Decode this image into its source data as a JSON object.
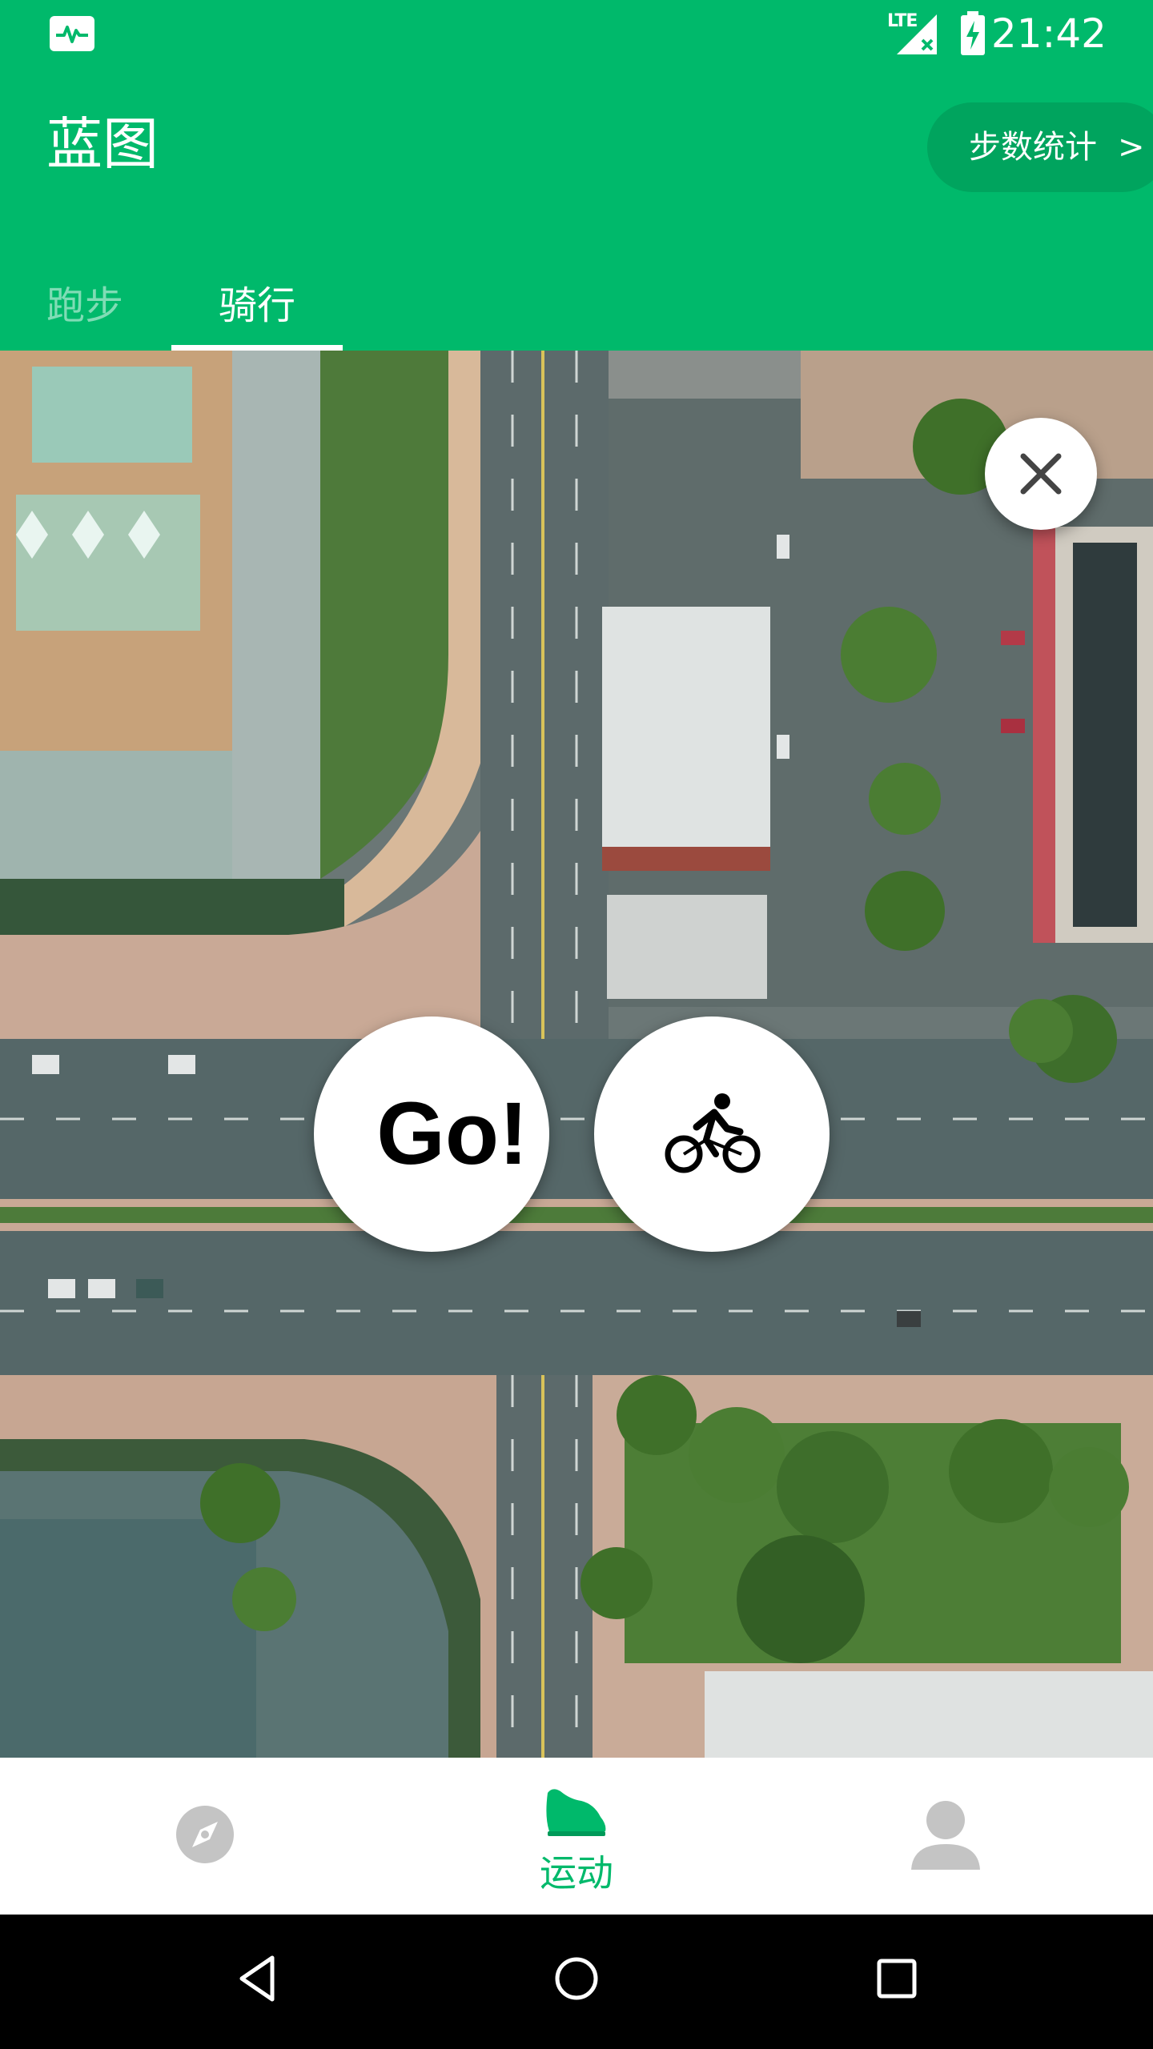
{
  "status_bar": {
    "network": "LTE",
    "time": "21:42",
    "icons": [
      "activity-app-icon",
      "signal-icon",
      "battery-charging-icon"
    ]
  },
  "app_bar": {
    "title": "蓝图",
    "steps_button_label": "步数统计",
    "steps_button_chevron": ">"
  },
  "tabs": [
    {
      "label": "跑步",
      "selected": false
    },
    {
      "label": "骑行",
      "selected": true
    }
  ],
  "map_overlay": {
    "close_icon": "close-icon",
    "go_label": "Go!",
    "mode_icon": "bike-icon"
  },
  "bottom_nav": [
    {
      "icon": "compass-icon",
      "label": "",
      "selected": false
    },
    {
      "icon": "shoe-icon",
      "label": "运动",
      "selected": true
    },
    {
      "icon": "person-icon",
      "label": "",
      "selected": false
    }
  ],
  "system_nav": [
    "back-icon",
    "home-icon",
    "recents-icon"
  ],
  "colors": {
    "primary": "#00B96B",
    "primary_dark": "#00A45E",
    "inactive_icon": "#BDBDBD"
  }
}
